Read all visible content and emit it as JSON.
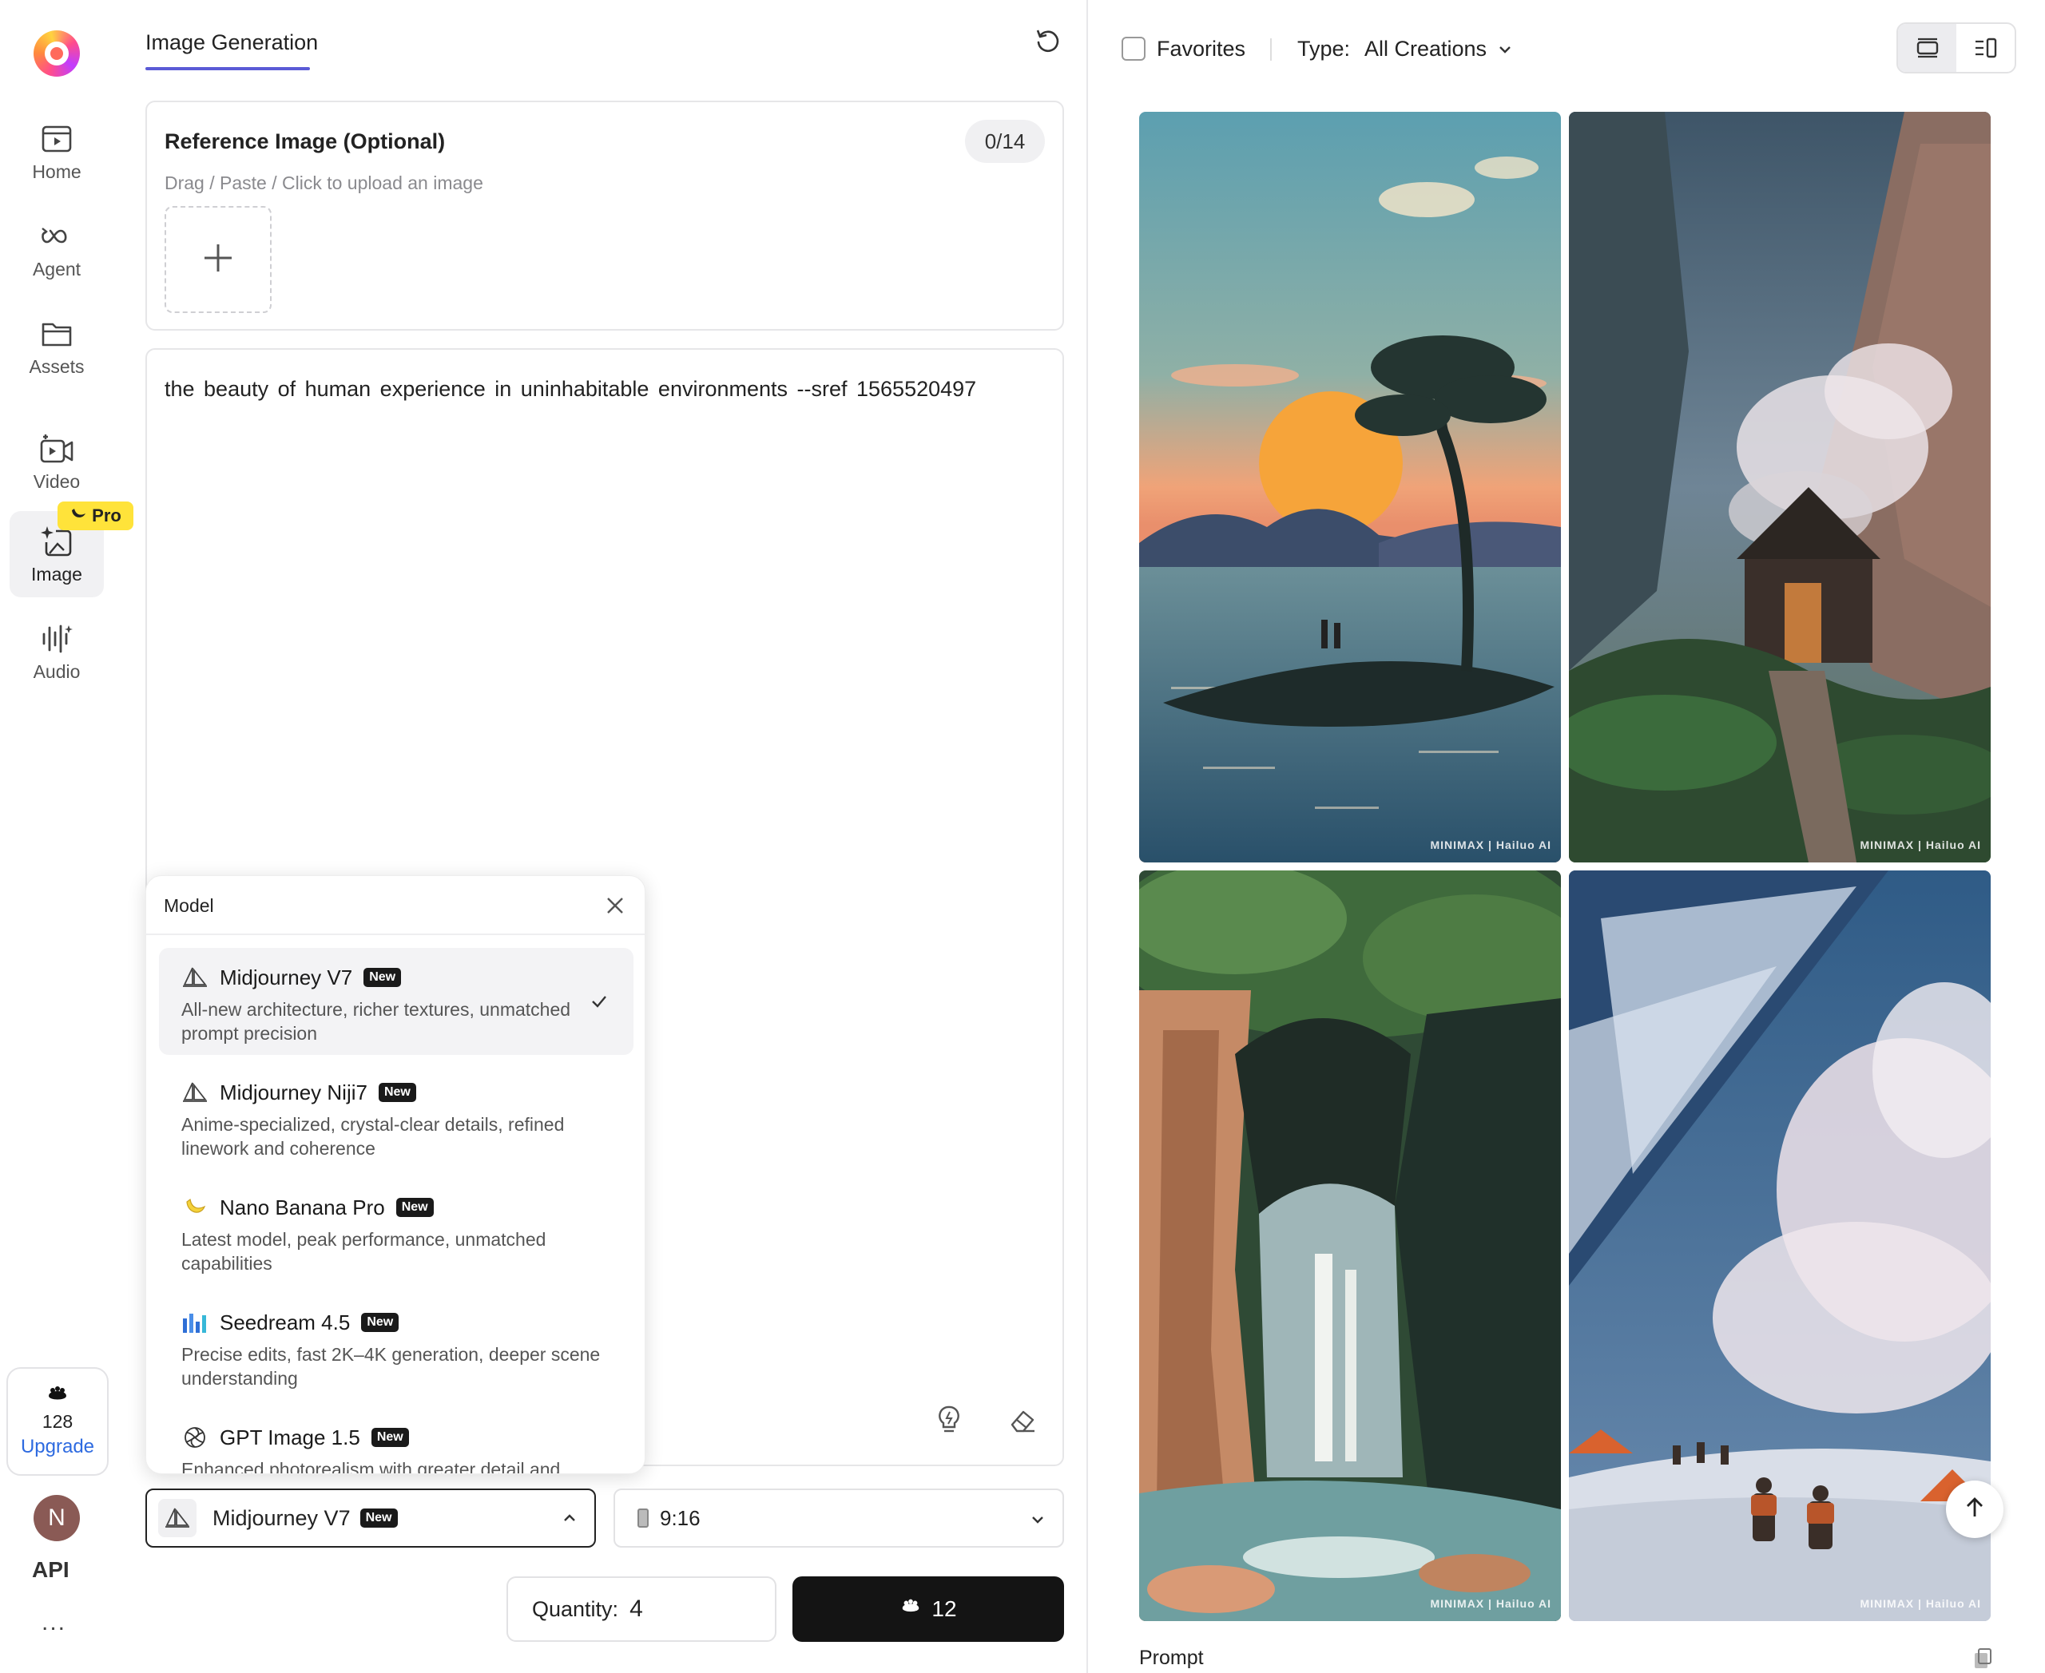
{
  "sidebar": {
    "items": [
      {
        "label": "Home",
        "icon": "home-icon"
      },
      {
        "label": "Agent",
        "icon": "infinity-icon"
      },
      {
        "label": "Assets",
        "icon": "folder-icon"
      },
      {
        "label": "Video",
        "icon": "video-icon"
      },
      {
        "label": "Image",
        "icon": "image-sparkle-icon"
      },
      {
        "label": "Audio",
        "icon": "audio-wave-icon"
      }
    ],
    "pro_badge": "Pro",
    "credits": "128",
    "upgrade": "Upgrade",
    "avatar_initial": "N",
    "api": "API",
    "more": "..."
  },
  "header": {
    "tab": "Image Generation"
  },
  "reference": {
    "title": "Reference Image (Optional)",
    "count": "0/14",
    "hint": "Drag / Paste / Click to upload an image"
  },
  "prompt": {
    "text": "the beauty of human experience in uninhabitable environments  --sref 1565520497"
  },
  "model_popup": {
    "title": "Model",
    "options": [
      {
        "name": "Midjourney V7",
        "badge": "New",
        "desc": "All-new architecture, richer textures, unmatched prompt precision",
        "selected": true
      },
      {
        "name": "Midjourney Niji7",
        "badge": "New",
        "desc": "Anime-specialized, crystal-clear details, refined linework and coherence",
        "selected": false
      },
      {
        "name": "Nano Banana Pro",
        "badge": "New",
        "desc": "Latest model, peak performance, unmatched capabilities",
        "selected": false
      },
      {
        "name": "Seedream 4.5",
        "badge": "New",
        "desc": "Precise edits, fast 2K–4K generation, deeper scene understanding",
        "selected": false
      },
      {
        "name": "GPT Image 1.5",
        "badge": "New",
        "desc": "Enhanced photorealism with greater detail and",
        "selected": false
      }
    ]
  },
  "model_select": {
    "name": "Midjourney V7",
    "badge": "New"
  },
  "ratio_select": {
    "value": "9:16"
  },
  "quantity": {
    "label": "Quantity:",
    "value": "4"
  },
  "generate": {
    "cost": "12"
  },
  "gallery": {
    "favorites": "Favorites",
    "type_label": "Type:",
    "type_value": "All Creations",
    "watermark": "MINIMAX | Hailuo AI",
    "prompt_label": "Prompt"
  }
}
